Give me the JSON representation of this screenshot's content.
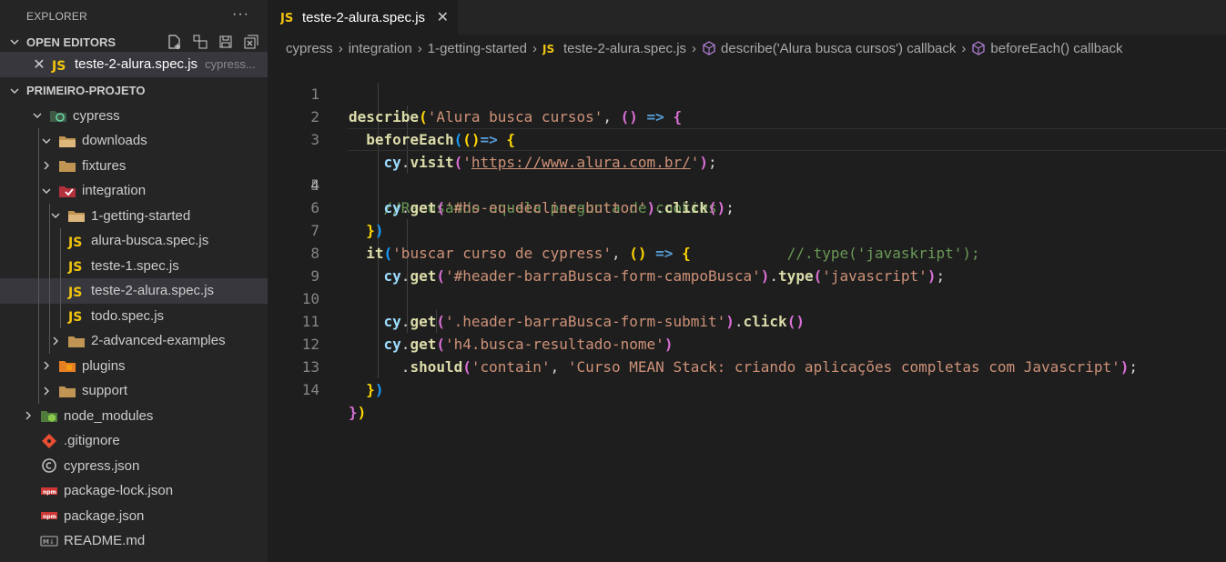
{
  "explorer": {
    "title": "EXPLORER",
    "more_label": "···",
    "open_editors": {
      "label": "OPEN EDITORS",
      "items": [
        {
          "name": "teste-2-alura.spec.js",
          "description": "cypress..."
        }
      ]
    },
    "project": {
      "label": "PRIMEIRO-PROJETO",
      "tree": [
        {
          "label": "cypress"
        },
        {
          "label": "downloads"
        },
        {
          "label": "fixtures"
        },
        {
          "label": "integration"
        },
        {
          "label": "1-getting-started"
        },
        {
          "label": "alura-busca.spec.js"
        },
        {
          "label": "teste-1.spec.js"
        },
        {
          "label": "teste-2-alura.spec.js"
        },
        {
          "label": "todo.spec.js"
        },
        {
          "label": "2-advanced-examples"
        },
        {
          "label": "plugins"
        },
        {
          "label": "support"
        },
        {
          "label": "node_modules"
        },
        {
          "label": ".gitignore"
        },
        {
          "label": "cypress.json"
        },
        {
          "label": "package-lock.json"
        },
        {
          "label": "package.json"
        },
        {
          "label": "README.md"
        }
      ]
    }
  },
  "editor": {
    "tab": {
      "label": "teste-2-alura.spec.js",
      "close": "✕"
    },
    "breadcrumbs": [
      "cypress",
      "integration",
      "1-getting-started",
      "teste-2-alura.spec.js",
      "describe('Alura busca cursos') callback",
      "beforeEach() callback"
    ],
    "line_numbers": [
      "1",
      "2",
      "3",
      "4",
      "5",
      "6",
      "7",
      "8",
      "9",
      "10",
      "11",
      "12",
      "13",
      "14"
    ],
    "current_line": "4",
    "code": {
      "l1": {
        "fn": "describe",
        "str": "'Alura busca cursos'",
        "arrow": "=>"
      },
      "l2": {
        "fn": "beforeEach",
        "arrow": "=>"
      },
      "l3": {
        "obj": "cy",
        "fn": "visit",
        "str_open": "'",
        "url": "https://www.alura.com.br/",
        "str_close": "'"
      },
      "l4": {
        "comment": "//Recusando aquela pergunta de cookies"
      },
      "l5": {
        "obj": "cy",
        "fn": "get",
        "str": "'#hs-eu-decline-button'",
        "fn2": "click"
      },
      "l7": {
        "fn": "it",
        "str": "'buscar curso de cypress'",
        "arrow": "=>",
        "comment": "//.type('javaskript');"
      },
      "l8": {
        "obj": "cy",
        "fn": "get",
        "str": "'#header-barraBusca-form-campoBusca'",
        "fn2": "type",
        "str2": "'javascript'"
      },
      "l10": {
        "obj": "cy",
        "fn": "get",
        "str": "'.header-barraBusca-form-submit'",
        "fn2": "click"
      },
      "l11": {
        "obj": "cy",
        "fn": "get",
        "str": "'h4.busca-resultado-nome'"
      },
      "l12": {
        "fn": "should",
        "str": "'contain'",
        "str2": "'Curso MEAN Stack: criando aplicações completas com Javascript'"
      }
    }
  }
}
